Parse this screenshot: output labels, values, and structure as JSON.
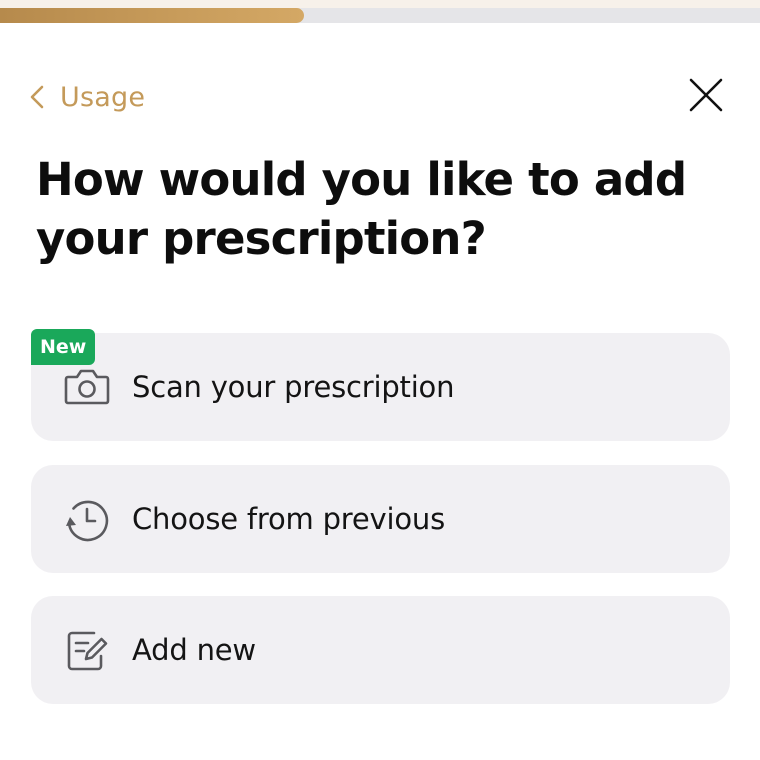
{
  "progress": {
    "fraction": 0.4,
    "fill_color": "#c49a5a"
  },
  "header": {
    "back_label": "Usage",
    "back_icon": "chevron-left-icon",
    "close_icon": "close-icon",
    "accent_color": "#c49a5a"
  },
  "title": "How would you like to add your prescription?",
  "options": [
    {
      "label": "Scan your prescription",
      "icon": "camera-icon",
      "badge": "New",
      "badge_color": "#1aa85a"
    },
    {
      "label": "Choose from previous",
      "icon": "history-icon"
    },
    {
      "label": "Add new",
      "icon": "edit-note-icon"
    }
  ]
}
